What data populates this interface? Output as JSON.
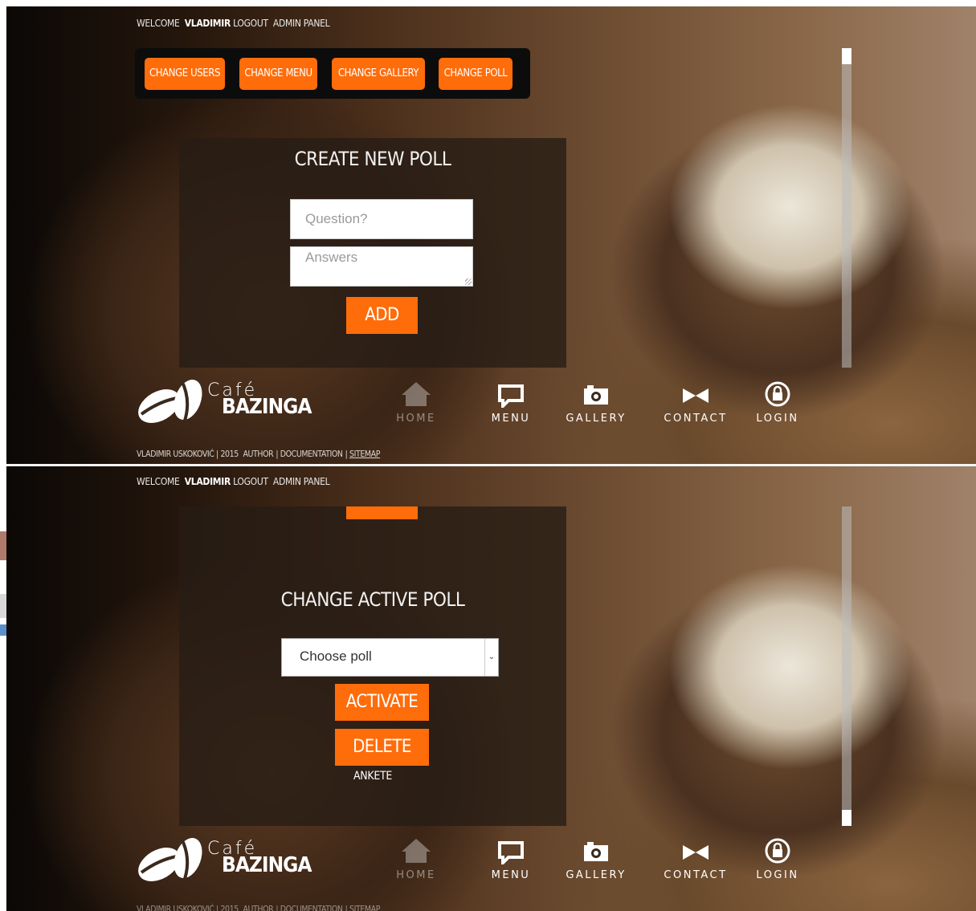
{
  "header": {
    "welcome_prefix": "WELCOME",
    "username": "VLADIMIR",
    "logout": "LOGOUT",
    "admin_panel": "ADMIN PANEL"
  },
  "admin_nav": [
    {
      "label": "CHANGE USERS"
    },
    {
      "label": "CHANGE MENU"
    },
    {
      "label": "CHANGE GALLERY"
    },
    {
      "label": "CHANGE POLL"
    }
  ],
  "create_poll": {
    "title": "CREATE NEW POLL",
    "question_placeholder": "Question?",
    "answers_placeholder": "Answers",
    "add_label": "ADD"
  },
  "active_poll": {
    "title": "CHANGE ACTIVE POLL",
    "select_value": "Choose poll",
    "activate_label": "ACTIVATE",
    "delete_label": "DELETE",
    "caption": "ANKETE"
  },
  "logo": {
    "small": "Café",
    "big": "BAZINGA"
  },
  "nav": [
    {
      "label": "HOME",
      "icon": "home-icon"
    },
    {
      "label": "MENU",
      "icon": "speech-bubble-icon"
    },
    {
      "label": "GALLERY",
      "icon": "camera-icon"
    },
    {
      "label": "CONTACT",
      "icon": "bowtie-icon"
    },
    {
      "label": "LOGIN",
      "icon": "lock-icon"
    }
  ],
  "footer": {
    "author_year": "VLADIMIR USKOKOVIĆ | 2015",
    "author": "AUTHOR",
    "documentation": "DOCUMENTATION",
    "sitemap": "SITEMAP"
  },
  "colors": {
    "accent": "#ff6c0a",
    "admin_bar": "#0c0c0c"
  }
}
